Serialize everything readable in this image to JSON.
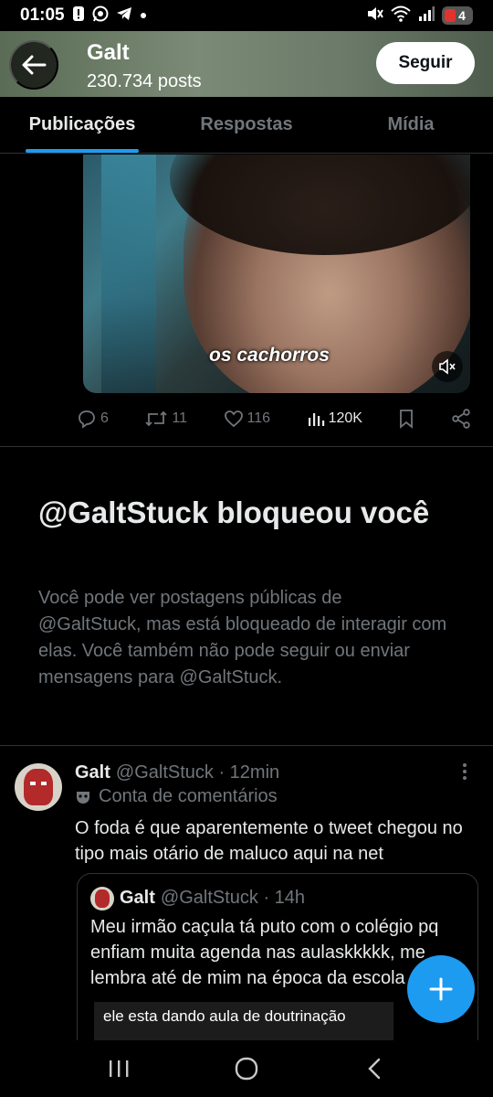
{
  "status_bar": {
    "time": "01:05",
    "battery": "4"
  },
  "header": {
    "name": "Galt",
    "posts": "230.734 posts",
    "follow_label": "Seguir"
  },
  "tabs": [
    {
      "label": "Publicações",
      "active": true
    },
    {
      "label": "Respostas",
      "active": false
    },
    {
      "label": "Mídia",
      "active": false
    }
  ],
  "media": {
    "caption": "os cachorros"
  },
  "actions": {
    "replies": "6",
    "reposts": "11",
    "likes": "116",
    "views": "120K"
  },
  "blocked": {
    "title": "@GaltStuck bloqueou você",
    "body": "Você pode ver postagens públicas de @GaltStuck, mas está bloqueado de interagir com elas. Você também não pode seguir ou enviar mensagens para @GaltStuck."
  },
  "tweet": {
    "name": "Galt",
    "handle": "@GaltStuck · 12min",
    "label": "Conta de comentários",
    "text": "O foda é que aparentemente o tweet chegou no tipo mais otário de maluco aqui na net"
  },
  "quote": {
    "name": "Galt",
    "handle": "@GaltStuck · 14h",
    "text": "Meu irmão caçula tá puto com o colégio pq enfiam muita agenda nas aulaskkkkk, me lembra até de mim na época da escola",
    "image_text": "ele esta dando aula de doutrinação"
  },
  "colors": {
    "accent": "#1d9bf0",
    "background": "#000000",
    "muted": "#71767b"
  }
}
